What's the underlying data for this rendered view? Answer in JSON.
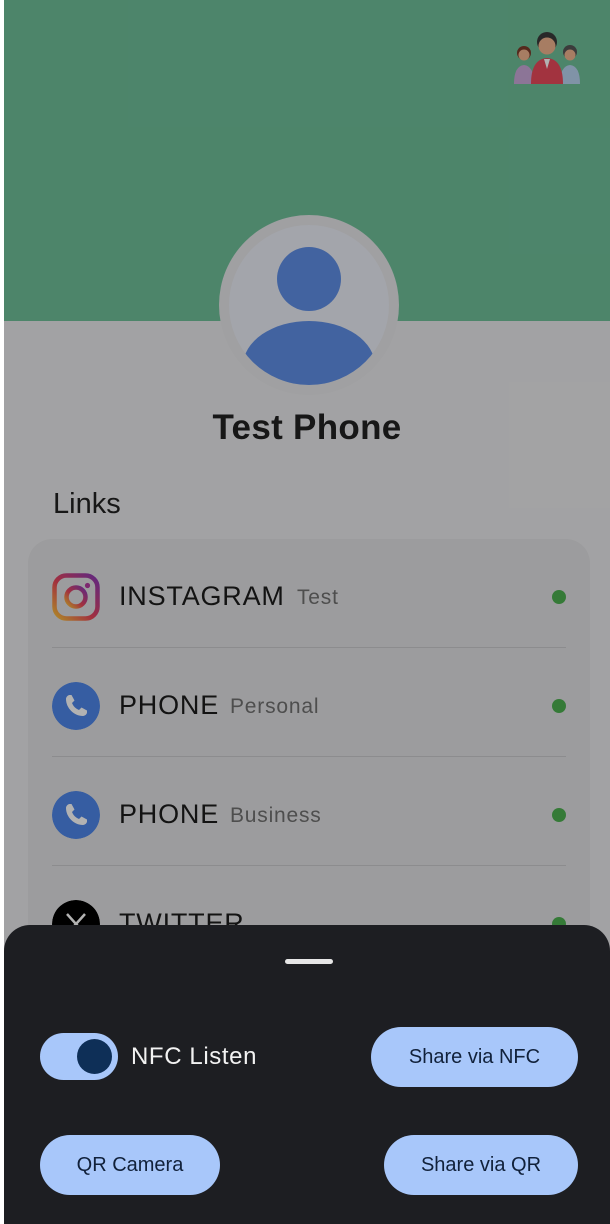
{
  "profile": {
    "name": "Test Phone"
  },
  "links": {
    "heading": "Links",
    "items": [
      {
        "title": "INSTAGRAM",
        "subtitle": "Test",
        "icon": "instagram-icon",
        "status": "active"
      },
      {
        "title": "PHONE",
        "subtitle": "Personal",
        "icon": "phone-icon",
        "status": "active"
      },
      {
        "title": "PHONE",
        "subtitle": "Business",
        "icon": "phone-icon",
        "status": "active"
      },
      {
        "title": "TWITTER",
        "subtitle": "",
        "icon": "x-logo-icon",
        "status": "active"
      }
    ]
  },
  "sheet": {
    "nfc_listen_label": "NFC Listen",
    "nfc_listen_on": true,
    "share_nfc_label": "Share via NFC",
    "qr_camera_label": "QR Camera",
    "share_qr_label": "Share via QR"
  },
  "colors": {
    "banner": "#6fbf99",
    "avatar": "#5f8fe6",
    "status_active": "#4caf50",
    "accent": "#a8c7fa",
    "sheet": "#1d1e22"
  }
}
